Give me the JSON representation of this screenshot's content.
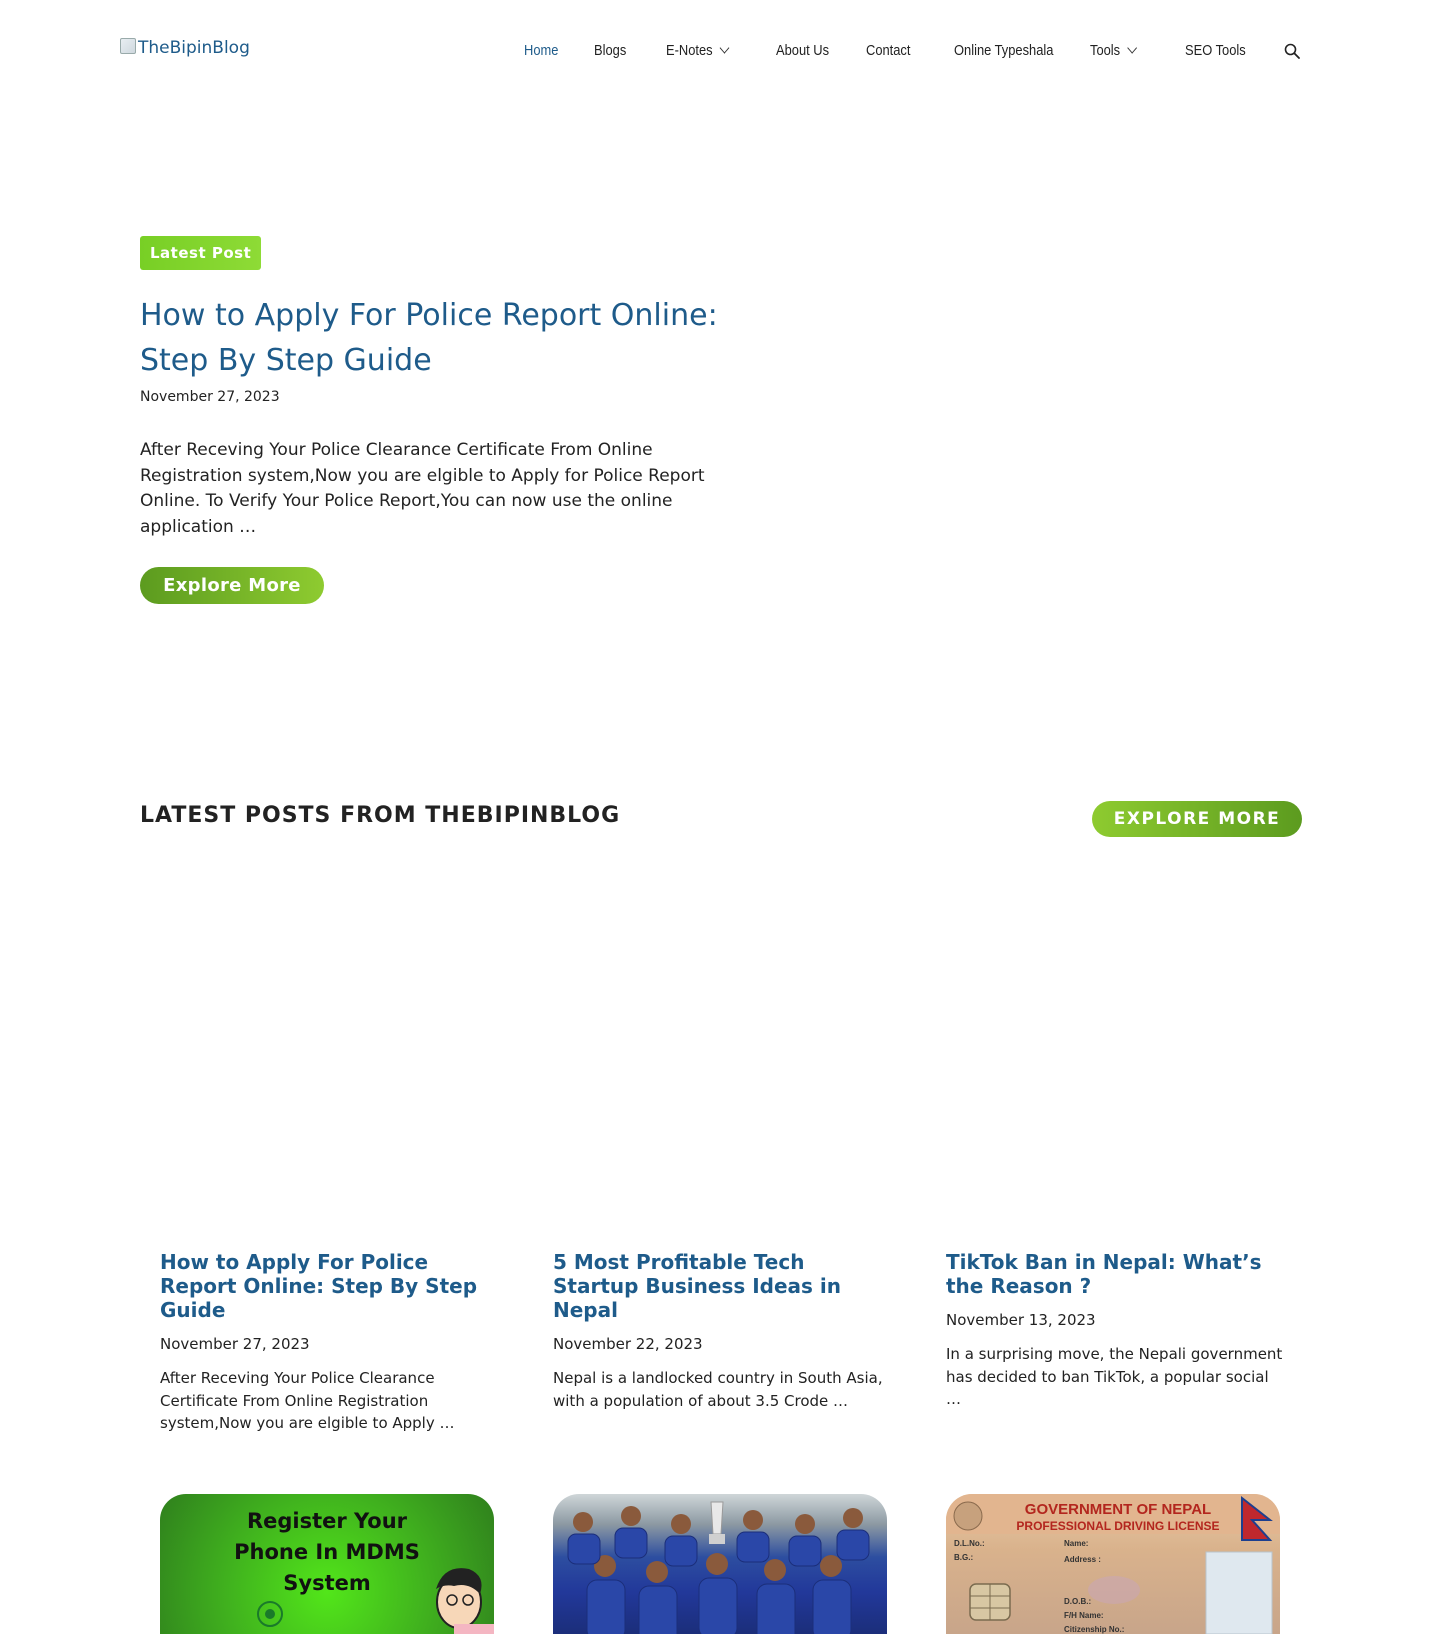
{
  "header": {
    "logo_alt": "TheBipinBlog",
    "nav": [
      {
        "label": "Home",
        "active": true,
        "has_dropdown": false
      },
      {
        "label": "Blogs",
        "active": false,
        "has_dropdown": false
      },
      {
        "label": "E-Notes",
        "active": false,
        "has_dropdown": true
      },
      {
        "label": "About Us",
        "active": false,
        "has_dropdown": false
      },
      {
        "label": "Contact",
        "active": false,
        "has_dropdown": false
      },
      {
        "label": "Online Typeshala",
        "active": false,
        "has_dropdown": false
      },
      {
        "label": "Tools",
        "active": false,
        "has_dropdown": true
      },
      {
        "label": "SEO Tools",
        "active": false,
        "has_dropdown": false
      }
    ],
    "search_icon": "search-icon"
  },
  "hero": {
    "badge": "Latest Post",
    "title": "How to Apply For Police Report Online: Step By Step Guide",
    "date": "November 27, 2023",
    "excerpt": "After Receving Your Police Clearance Certificate From Online Registration system,Now you are elgible to Apply for Police Report Online. To Verify Your Police Report,You can now use the online application …",
    "button": "Explore More"
  },
  "latest": {
    "title": "LATEST POSTS FROM THEBIPINBLOG",
    "button": "EXPLORE MORE",
    "posts": [
      {
        "title": "How to Apply For Police Report Online: Step By Step Guide",
        "date": "November 27, 2023",
        "excerpt": "After Receving Your Police Clearance Certificate From Online Registration system,Now you are elgible to Apply …"
      },
      {
        "title": "5 Most Profitable Tech Startup Business Ideas in Nepal",
        "date": "November 22, 2023",
        "excerpt": "Nepal is a landlocked country in South Asia, with a population of about 3.5 Crode …"
      },
      {
        "title": "TikTok Ban in Nepal: What’s the Reason ?",
        "date": "November 13, 2023",
        "excerpt": "In a surprising move, the Nepali government has decided to ban TikTok, a popular social …"
      }
    ],
    "thumbnails": [
      {
        "text": "Register Your Phone In MDMS System"
      },
      {
        "text": ""
      },
      {
        "text": ""
      }
    ]
  },
  "colors": {
    "link": "#1e5b8a",
    "accent_green": "#7ed321",
    "text": "#222222"
  }
}
